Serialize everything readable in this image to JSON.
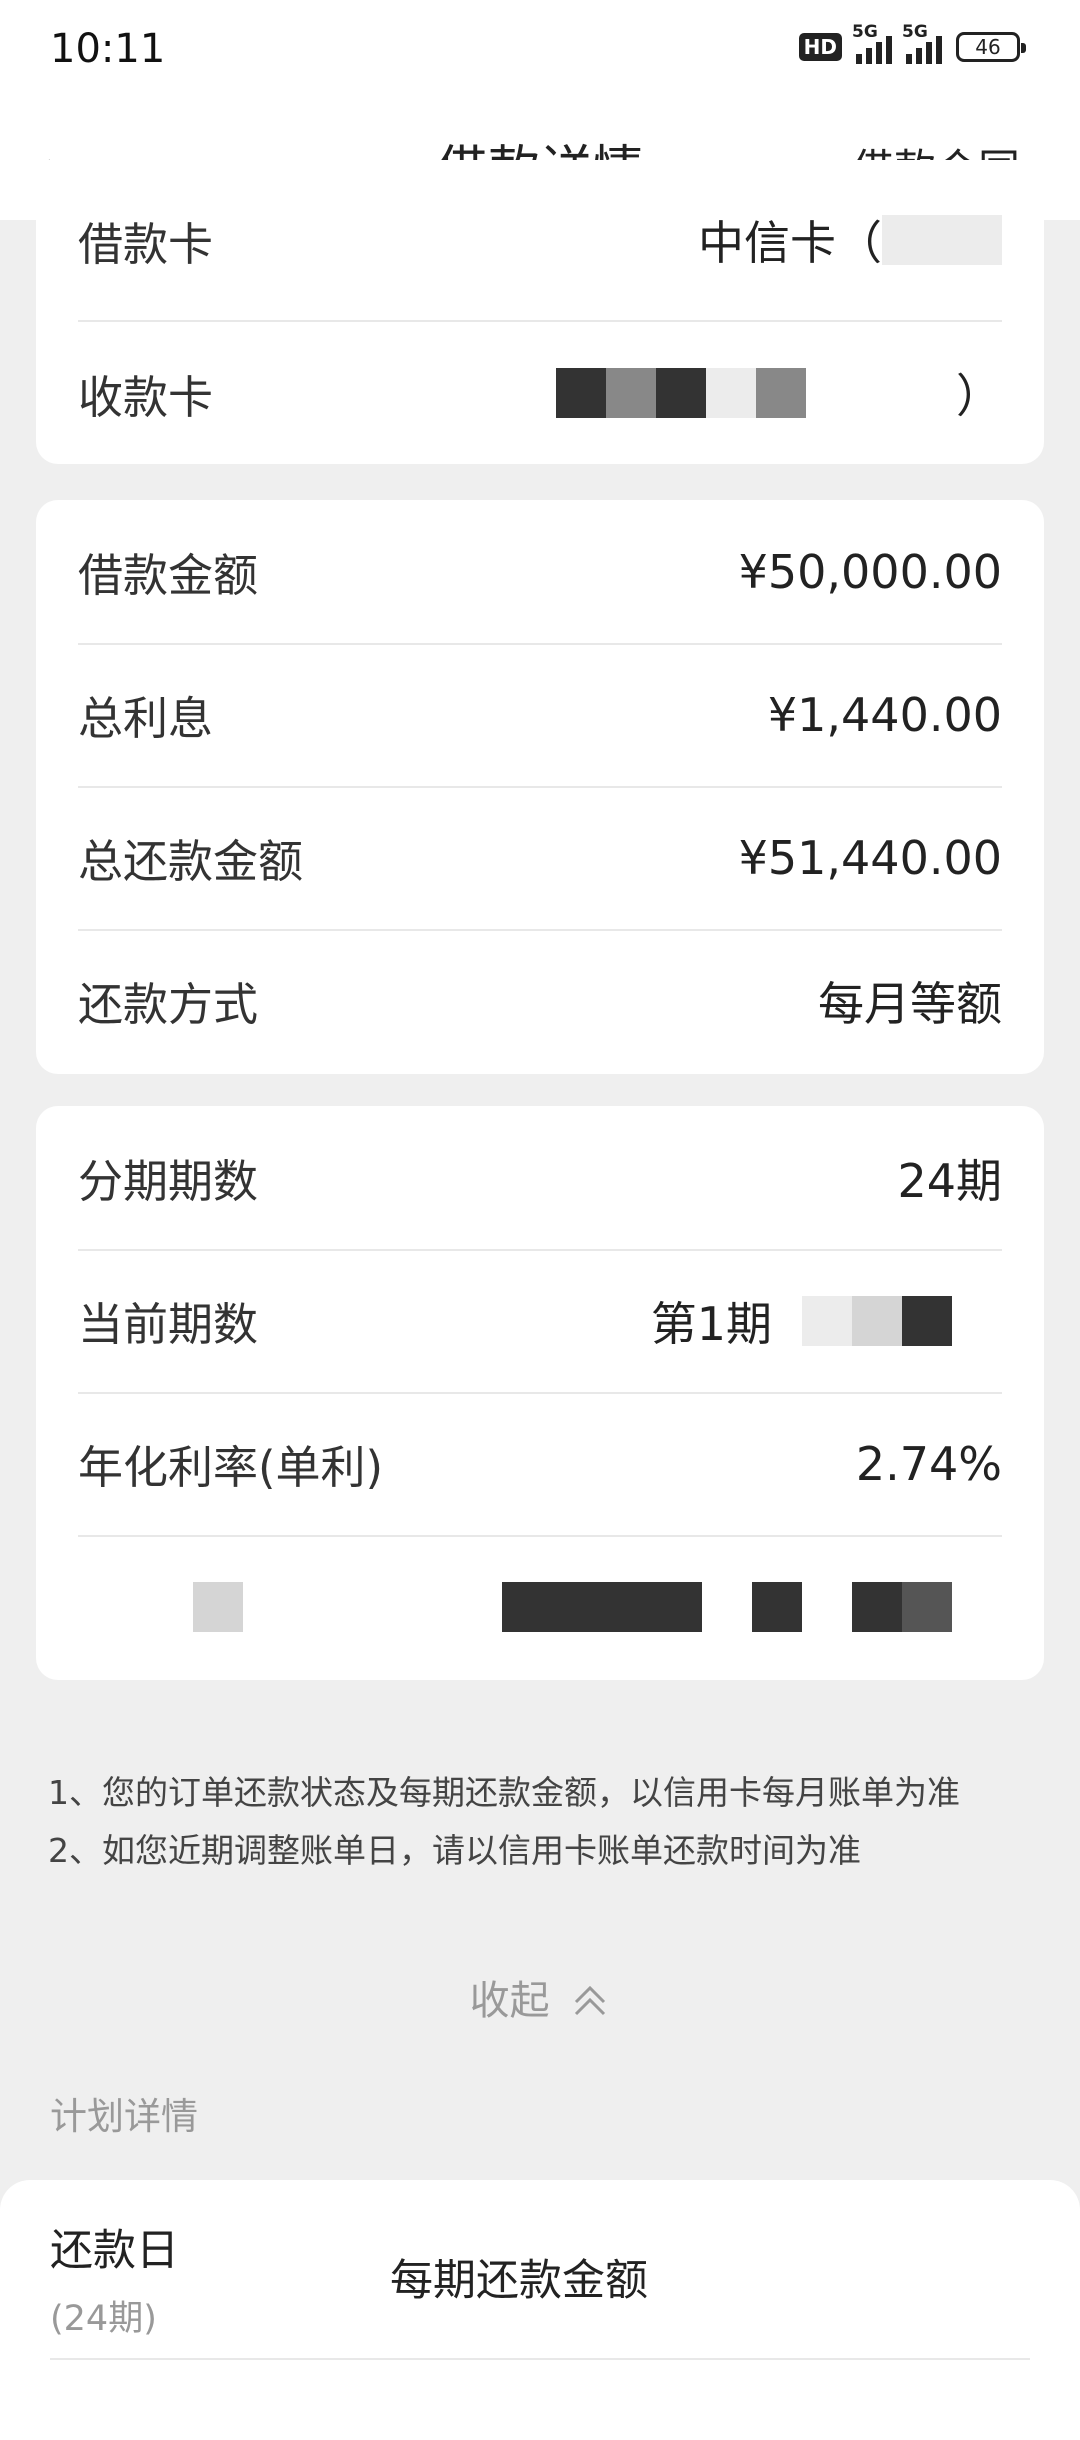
{
  "status": {
    "time": "10:11",
    "hd": "HD",
    "net1": "5G",
    "net2": "5G",
    "battery": "46"
  },
  "nav": {
    "back": "‹",
    "title": "借款详情",
    "right": "借款合同"
  },
  "card1": {
    "borrow_card_label": "借款卡",
    "borrow_card_value": "中信卡（",
    "receive_card_label": "收款卡",
    "receive_card_tail": "）"
  },
  "card2": {
    "amount_label": "借款金额",
    "amount_value": "¥50,000.00",
    "interest_label": "总利息",
    "interest_value": "¥1,440.00",
    "total_label": "总还款金额",
    "total_value": "¥51,440.00",
    "method_label": "还款方式",
    "method_value": "每月等额"
  },
  "card3": {
    "periods_label": "分期期数",
    "periods_value": "24期",
    "current_label": "当前期数",
    "current_value": "第1期",
    "rate_label": "年化利率(单利)",
    "rate_value": "2.74%"
  },
  "notes": {
    "line1": "1、您的订单还款状态及每期还款金额，以信用卡每月账单为准",
    "line2": "2、如您近期调整账单日，请以信用卡账单还款时间为准"
  },
  "collapse": {
    "label": "收起",
    "icon": "double-chevron-up-icon"
  },
  "plan": {
    "section_title": "计划详情",
    "col1_title": "还款日",
    "col1_sub": "(24期)",
    "col2_title": "每期还款金额"
  }
}
